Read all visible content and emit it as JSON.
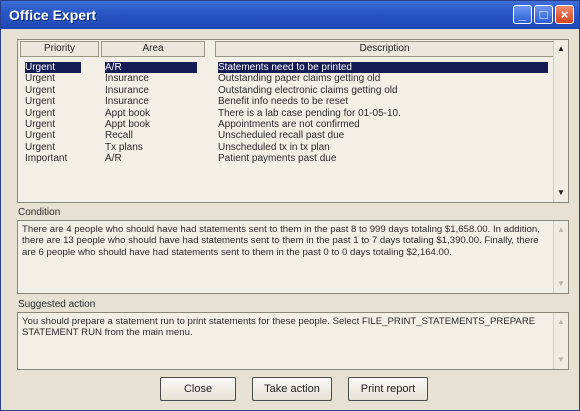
{
  "window": {
    "title": "Office Expert"
  },
  "list": {
    "headers": {
      "priority": "Priority",
      "area": "Area",
      "description": "Description"
    },
    "rows": [
      {
        "priority": "Urgent",
        "area": "A/R",
        "description": "Statements need to be printed"
      },
      {
        "priority": "Urgent",
        "area": "Insurance",
        "description": "Outstanding paper claims getting old"
      },
      {
        "priority": "Urgent",
        "area": "Insurance",
        "description": "Outstanding electronic claims getting old"
      },
      {
        "priority": "Urgent",
        "area": "Insurance",
        "description": "Benefit info needs to be reset"
      },
      {
        "priority": "Urgent",
        "area": "Appt book",
        "description": "There is a lab case pending for 01-05-10."
      },
      {
        "priority": "Urgent",
        "area": "Appt book",
        "description": "Appointments are not confirmed"
      },
      {
        "priority": "Urgent",
        "area": "Recall",
        "description": "Unscheduled recall past due"
      },
      {
        "priority": "Urgent",
        "area": "Tx plans",
        "description": "Unscheduled tx in tx plan"
      },
      {
        "priority": "Important",
        "area": "A/R",
        "description": "Patient payments past due"
      }
    ]
  },
  "condition": {
    "label": "Condition",
    "text": "There are 4 people who should have had statements sent to them in the past 8 to 999 days totaling $1,658.00.  In addition, there are 13 people who should have had statements sent to them in the past 1 to 7 days totaling $1,390.00.  Finally, there are 6 people who should have had statements sent to them in the past 0 to 0 days totaling $2,164.00."
  },
  "suggested": {
    "label": "Suggested action",
    "text": "You should prepare a statement run to print statements for these people. Select FILE_PRINT_STATEMENTS_PREPARE STATEMENT RUN from the main menu."
  },
  "buttons": {
    "close": "Close",
    "take_action": "Take action",
    "print_report": "Print report"
  },
  "colors": {
    "title_bar": "#2a57c6",
    "selection": "#151b55",
    "window_bg": "#e6e1d2",
    "close_button": "#d2441d"
  }
}
